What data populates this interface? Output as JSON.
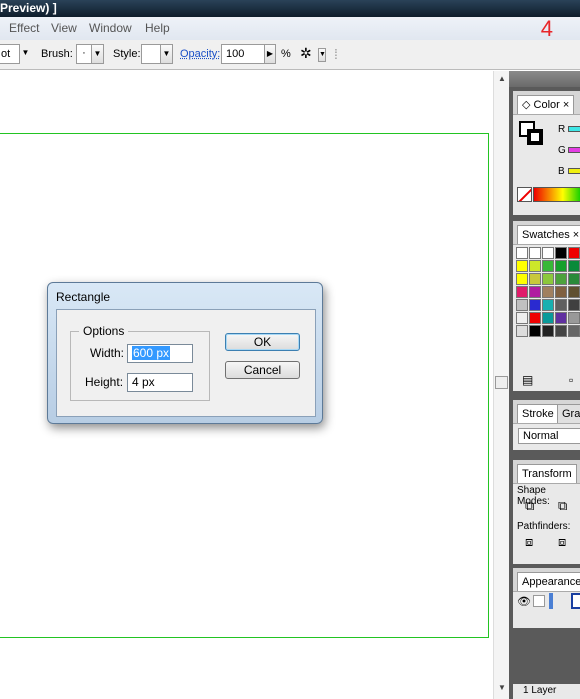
{
  "window": {
    "title": "Preview) ]",
    "step_number": "4"
  },
  "menu": {
    "items": [
      "Effect",
      "View",
      "Window",
      "Help"
    ]
  },
  "toolbar": {
    "partial_dropdown": "ot",
    "brush_label": "Brush:",
    "brush_value": "·",
    "style_label": "Style:",
    "opacity_label": "Opacity:",
    "opacity_value": "100",
    "percent": "%"
  },
  "dialog": {
    "title": "Rectangle",
    "group_label": "Options",
    "width_label": "Width:",
    "width_value": "600 px",
    "height_label": "Height:",
    "height_value": "4 px",
    "ok_label": "OK",
    "cancel_label": "Cancel"
  },
  "panels": {
    "color_tab": "Color",
    "channels": [
      "R",
      "G",
      "B"
    ],
    "swatches_tab": "Swatches",
    "stroke_tab": "Stroke",
    "gradient_tab": "Grad",
    "blend_mode": "Normal",
    "transform_tab": "Transform",
    "shape_modes": "Shape Modes:",
    "pathfinders": "Pathfinders:",
    "appearance_tab": "Appearance",
    "layers_status": "1 Layer"
  },
  "colors": {
    "artboard_border": "#22c422",
    "step_number": "#e8262a",
    "selection": "#3399ff"
  }
}
